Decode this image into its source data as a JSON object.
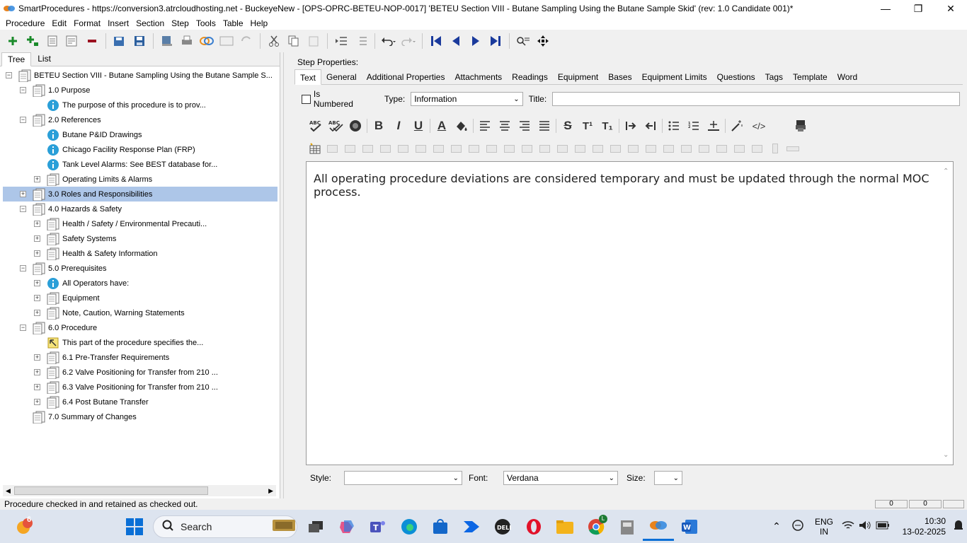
{
  "window": {
    "title": "SmartProcedures - https://conversion3.atrcloudhosting.net - BuckeyeNew - [OPS-OPRC-BETEU-NOP-0017] 'BETEU Section VIII - Butane Sampling Using the Butane Sample Skid' (rev: 1.0 Candidate 001)*",
    "minimize_label": "—",
    "maximize_label": "❐",
    "close_label": "✕"
  },
  "menu": [
    "Procedure",
    "Edit",
    "Format",
    "Insert",
    "Section",
    "Step",
    "Tools",
    "Table",
    "Help"
  ],
  "left_panel": {
    "tabs": [
      "Tree",
      "List"
    ],
    "tree": [
      {
        "label": "BETEU Section VIII - Butane Sampling Using the Butane Sample S...",
        "level": 0,
        "expander": "−",
        "icon": "document-icon"
      },
      {
        "label": "1.0 Purpose",
        "level": 1,
        "expander": "−",
        "icon": "section-icon"
      },
      {
        "label": "The purpose of this procedure is to prov...",
        "level": 2,
        "expander": "",
        "icon": "info-icon"
      },
      {
        "label": "2.0 References",
        "level": 1,
        "expander": "−",
        "icon": "section-icon"
      },
      {
        "label": "Butane P&ID Drawings",
        "level": 2,
        "expander": "",
        "icon": "info-icon"
      },
      {
        "label": "Chicago Facility Response Plan (FRP)",
        "level": 2,
        "expander": "",
        "icon": "info-icon"
      },
      {
        "label": "Tank Level Alarms: See BEST database for...",
        "level": 2,
        "expander": "",
        "icon": "info-icon"
      },
      {
        "label": "Operating Limits & Alarms",
        "level": 2,
        "expander": "+",
        "icon": "section-icon"
      },
      {
        "label": "3.0 Roles and Responsibilities",
        "level": 1,
        "expander": "+",
        "icon": "section-icon",
        "selected": true
      },
      {
        "label": "4.0 Hazards & Safety",
        "level": 1,
        "expander": "−",
        "icon": "section-icon"
      },
      {
        "label": "Health / Safety / Environmental Precauti...",
        "level": 2,
        "expander": "+",
        "icon": "section-icon"
      },
      {
        "label": "Safety Systems",
        "level": 2,
        "expander": "+",
        "icon": "section-icon"
      },
      {
        "label": "Health & Safety Information",
        "level": 2,
        "expander": "+",
        "icon": "section-icon"
      },
      {
        "label": "5.0 Prerequisites",
        "level": 1,
        "expander": "−",
        "icon": "section-icon"
      },
      {
        "label": "All Operators have:",
        "level": 2,
        "expander": "+",
        "icon": "info-icon"
      },
      {
        "label": "Equipment",
        "level": 2,
        "expander": "+",
        "icon": "section-icon"
      },
      {
        "label": "Note, Caution, Warning Statements",
        "level": 2,
        "expander": "+",
        "icon": "section-icon"
      },
      {
        "label": "6.0 Procedure",
        "level": 1,
        "expander": "−",
        "icon": "section-icon"
      },
      {
        "label": "This part of the procedure specifies the...",
        "level": 2,
        "expander": "",
        "icon": "note-icon"
      },
      {
        "label": "6.1 Pre-Transfer Requirements",
        "level": 2,
        "expander": "+",
        "icon": "section-icon"
      },
      {
        "label": "6.2 Valve Positioning for Transfer from 210 ...",
        "level": 2,
        "expander": "+",
        "icon": "section-icon"
      },
      {
        "label": "6.3 Valve Positioning for Transfer from 210 ...",
        "level": 2,
        "expander": "+",
        "icon": "section-icon"
      },
      {
        "label": "6.4 Post Butane Transfer",
        "level": 2,
        "expander": "+",
        "icon": "section-icon"
      },
      {
        "label": "7.0 Summary of Changes",
        "level": 1,
        "expander": "",
        "icon": "section-icon"
      }
    ]
  },
  "step_properties": {
    "label": "Step Properties:",
    "tabs": [
      "Text",
      "General",
      "Additional Properties",
      "Attachments",
      "Readings",
      "Equipment",
      "Bases",
      "Equipment Limits",
      "Questions",
      "Tags",
      "Template",
      "Word"
    ],
    "is_numbered_label": "Is Numbered",
    "type_label": "Type:",
    "type_value": "Information",
    "title_label": "Title:",
    "title_value": "",
    "editor_text": "All operating procedure deviations are considered temporary and must be updated through the normal MOC process.",
    "style_label": "Style:",
    "style_value": "",
    "font_label": "Font:",
    "font_value": "Verdana",
    "size_label": "Size:",
    "size_value": ""
  },
  "format_toolbar": {
    "bold": "B",
    "italic": "I",
    "underline": "U",
    "font_color": "A",
    "strike": "S",
    "superscript": "T¹",
    "subscript": "T₁",
    "html": "</>"
  },
  "status_bar": {
    "message": "Procedure checked in and retained as checked out.",
    "cell1": "0",
    "cell2": "0"
  },
  "taskbar": {
    "search_label": "Search",
    "notification_count": "6",
    "chrome_badge": "L",
    "lang": "ENG",
    "region": "IN",
    "time": "10:30",
    "date": "13-02-2025"
  },
  "colors": {
    "selection": "#adc6e8",
    "info_icon": "#2a9fd8",
    "taskbar": "#dde4ef"
  }
}
